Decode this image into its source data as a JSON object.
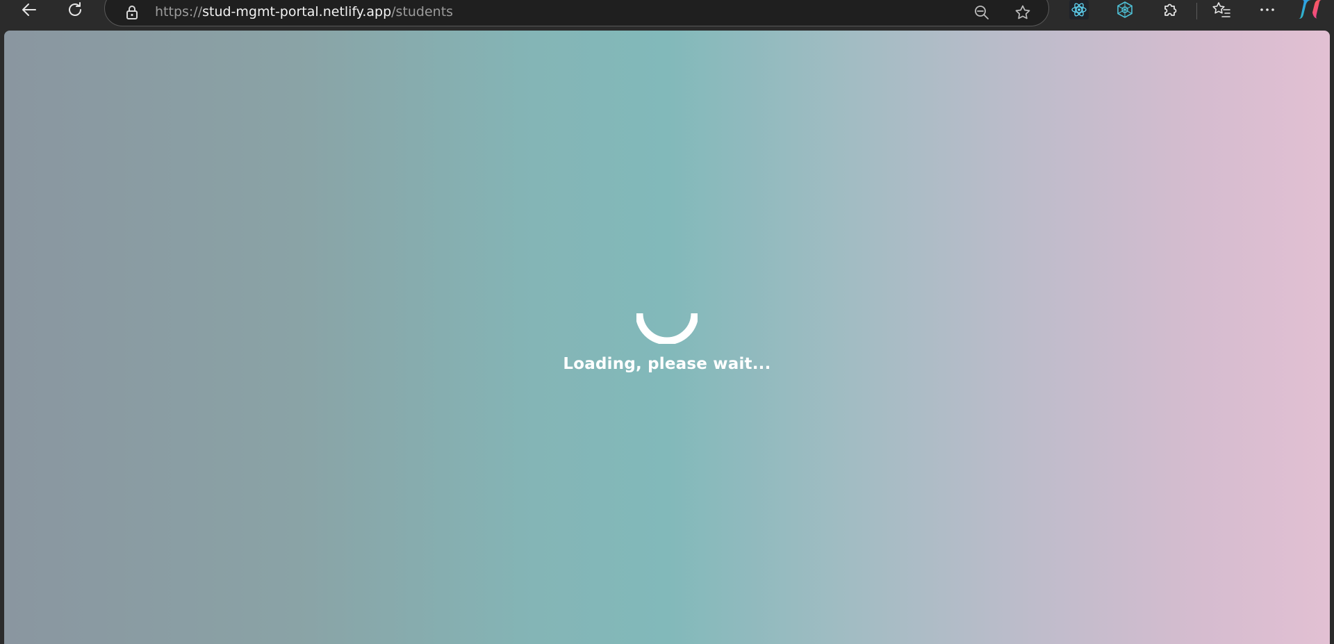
{
  "browser": {
    "url_scheme": "https://",
    "url_host": "stud-mgmt-portal.netlify.app",
    "url_path": "/students",
    "icons": [
      "back-icon",
      "refresh-icon",
      "lock-icon",
      "zoom-out-icon",
      "star-icon",
      "react-devtools-icon",
      "extension-icon",
      "puzzle-icon",
      "favorites-icon",
      "more-icon",
      "copilot-icon"
    ]
  },
  "page": {
    "loading_text": "Loading, please wait..."
  },
  "colors": {
    "gradient_left": "#8a96a0",
    "gradient_center": "#82b9ba",
    "gradient_right": "#e2c0d3",
    "spinner": "#ffffff"
  }
}
